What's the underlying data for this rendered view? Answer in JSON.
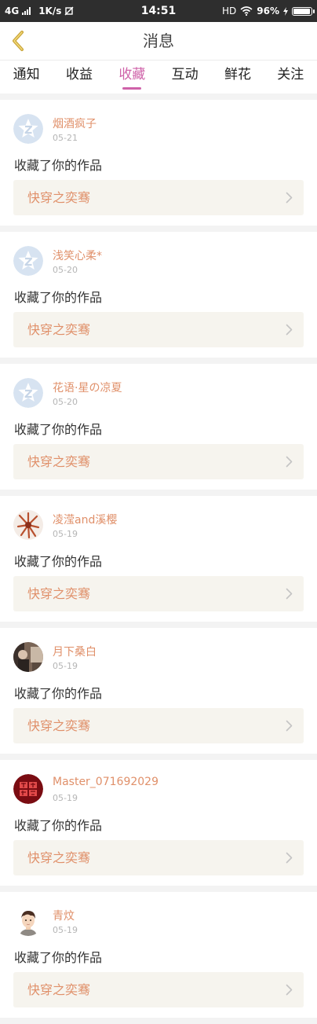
{
  "status_bar": {
    "network": "4G",
    "speed": "1K/s",
    "time": "14:51",
    "hd": "HD",
    "battery_text": "96%",
    "battery_level": 0.96
  },
  "header": {
    "title": "消息"
  },
  "tabs": [
    {
      "label": "通知",
      "active": false
    },
    {
      "label": "收益",
      "active": false
    },
    {
      "label": "收藏",
      "active": true
    },
    {
      "label": "互动",
      "active": false
    },
    {
      "label": "鲜花",
      "active": false
    },
    {
      "label": "关注",
      "active": false
    }
  ],
  "colors": {
    "accent": "#cf62a9",
    "username": "#e0906a",
    "card_work_bg": "#f6f4ee"
  },
  "messages": [
    {
      "user": "烟酒疯子",
      "date": "05-21",
      "action": "收藏了你的作品",
      "work": "快穿之奕骞",
      "avatar": "default-avatar-icon"
    },
    {
      "user": "浅笑心柔*",
      "date": "05-20",
      "action": "收藏了你的作品",
      "work": "快穿之奕骞",
      "avatar": "default-avatar-icon"
    },
    {
      "user": "花语·星の凉夏",
      "date": "05-20",
      "action": "收藏了你的作品",
      "work": "快穿之奕骞",
      "avatar": "default-avatar-icon"
    },
    {
      "user": "凌滢and溪樱",
      "date": "05-19",
      "action": "收藏了你的作品",
      "work": "快穿之奕骞",
      "avatar": "flower-avatar"
    },
    {
      "user": "月下桑白",
      "date": "05-19",
      "action": "收藏了你的作品",
      "work": "快穿之奕骞",
      "avatar": "photo-avatar"
    },
    {
      "user": "Master_071692029",
      "date": "05-19",
      "action": "收藏了你的作品",
      "work": "快穿之奕骞",
      "avatar": "red-seal-avatar"
    },
    {
      "user": "青炆",
      "date": "05-19",
      "action": "收藏了你的作品",
      "work": "快穿之奕骞",
      "avatar": "boy-avatar"
    }
  ]
}
